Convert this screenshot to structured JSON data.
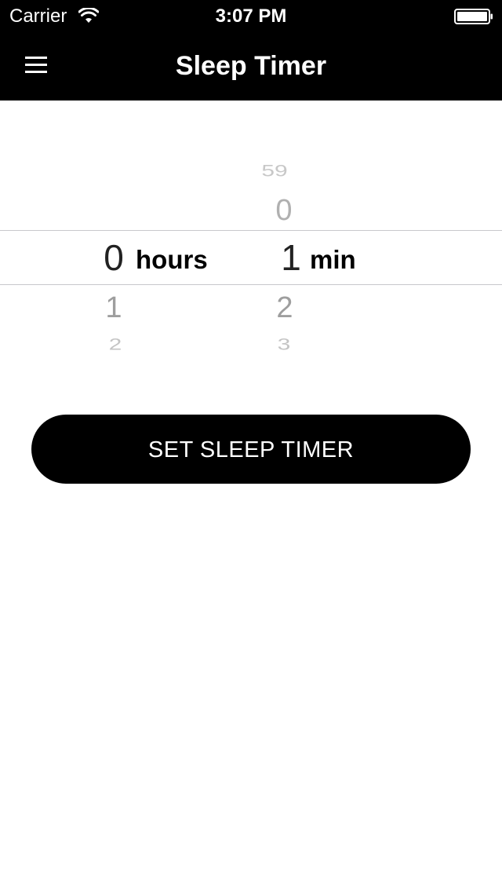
{
  "status_bar": {
    "carrier": "Carrier",
    "time": "3:07 PM",
    "icons": [
      "wifi-icon",
      "battery-icon"
    ]
  },
  "nav": {
    "title": "Sleep Timer",
    "menu_icon": "menu-icon"
  },
  "picker": {
    "hours": {
      "above": [],
      "selected": "0",
      "below": [
        "1",
        "2"
      ],
      "unit": "hours"
    },
    "minutes": {
      "above": [
        "59",
        "0"
      ],
      "selected": "1",
      "below": [
        "2",
        "3"
      ],
      "unit": "min"
    }
  },
  "button": {
    "label": "SET SLEEP TIMER"
  },
  "colors": {
    "bar_background": "#000000",
    "button_background": "#000000",
    "picker_faded": "#a8a8a8",
    "picker_divider": "#c8c8cc"
  }
}
